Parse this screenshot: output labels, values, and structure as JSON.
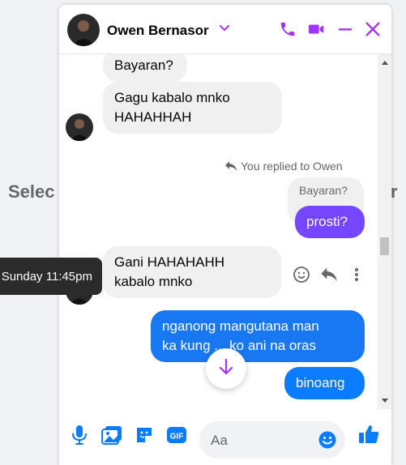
{
  "background": {
    "left_text": "Selec",
    "right_text": "r"
  },
  "header": {
    "contact_name": "Owen Bernasor"
  },
  "messages": {
    "m1": "Bayaran?",
    "m2_line1": "Gagu kabalo mnko",
    "m2_line2": "HAHAHHAH",
    "reply_note": "You replied to Owen",
    "quoted": "Bayaran?",
    "m3": "prosti?",
    "m4_line1": "Gani HAHAHAHH",
    "m4_line2": "kabalo mnko",
    "m5_line1": "nganong mangutana man",
    "m5_line2": "ka kung ... ko ani na oras",
    "m6": "binoang"
  },
  "tooltip": {
    "timestamp": "Sunday 11:45pm"
  },
  "composer": {
    "placeholder": "Aa",
    "gif_label": "GIF"
  },
  "colors": {
    "accent": "#a033ff",
    "brand_blue": "#0a7cff",
    "outgoing_purple": "#7646ff"
  },
  "icons": [
    "chevron-down-icon",
    "phone-icon",
    "video-icon",
    "minimize-icon",
    "close-icon",
    "emoji-icon",
    "reply-icon",
    "more-icon",
    "arrow-down-icon",
    "microphone-icon",
    "photo-icon",
    "sticker-icon",
    "gif-icon",
    "thumbs-up-icon"
  ]
}
